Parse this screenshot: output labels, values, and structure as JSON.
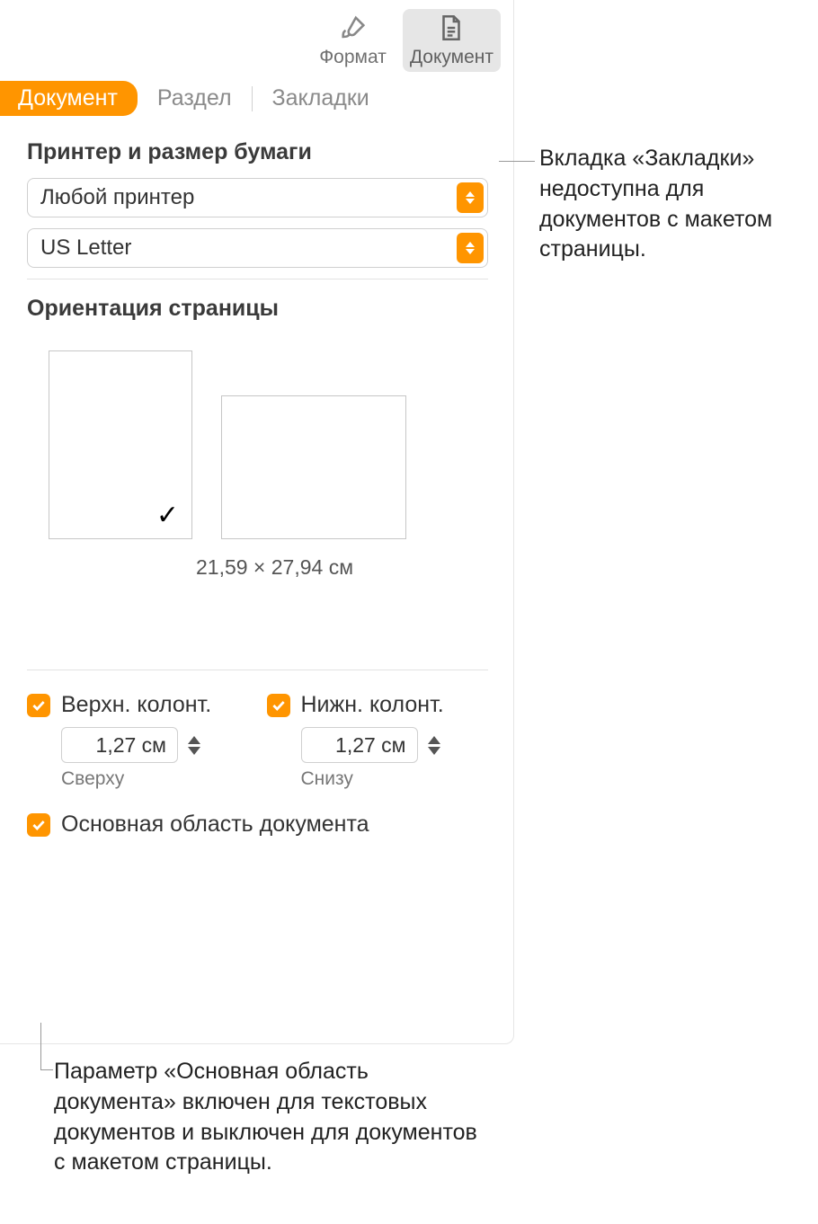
{
  "toolbar": {
    "format_label": "Формат",
    "document_label": "Документ"
  },
  "tabs": {
    "document": "Документ",
    "section": "Раздел",
    "bookmarks": "Закладки"
  },
  "printer_section": {
    "title": "Принтер и размер бумаги",
    "printer_value": "Любой принтер",
    "paper_value": "US Letter"
  },
  "orientation": {
    "title": "Ориентация страницы",
    "dimensions": "21,59 × 27,94 см"
  },
  "header_footer": {
    "header_label": "Верхн. колонт.",
    "footer_label": "Нижн. колонт.",
    "header_value": "1,27 см",
    "footer_value": "1,27 см",
    "top_label": "Сверху",
    "bottom_label": "Снизу"
  },
  "body": {
    "label": "Основная область документа"
  },
  "callouts": {
    "bookmarks": "Вкладка «Закладки» недоступна для документов с макетом страницы.",
    "body": "Параметр «Основная область документа» включен для текстовых документов и выключен для документов с макетом страницы."
  }
}
